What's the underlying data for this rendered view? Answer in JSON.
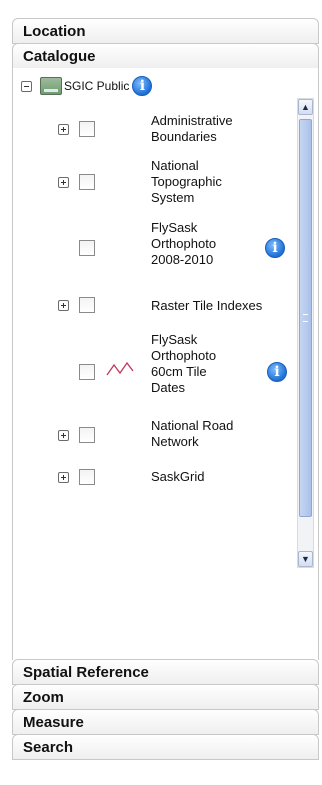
{
  "panels": {
    "location": "Location",
    "catalogue": "Catalogue",
    "spatial_reference": "Spatial Reference",
    "zoom": "Zoom",
    "measure": "Measure",
    "search": "Search"
  },
  "tree": {
    "root_label": "SGIC Public",
    "layers": [
      {
        "label": "Administrative Boundaries"
      },
      {
        "label": "National Topographic System"
      },
      {
        "label": "FlySask Orthophoto 2008-2010"
      },
      {
        "label": "Raster Tile Indexes"
      },
      {
        "label": "FlySask Orthophoto 60cm Tile Dates"
      },
      {
        "label": "National Road Network"
      },
      {
        "label": "SaskGrid"
      }
    ]
  },
  "icons": {
    "info": "i",
    "scroll_up": "▲",
    "scroll_down": "▼"
  },
  "colors": {
    "info_blue": "#1d6fd6",
    "legend_line": "#c0395a",
    "scroll_thumb": "#a9c1ea"
  }
}
